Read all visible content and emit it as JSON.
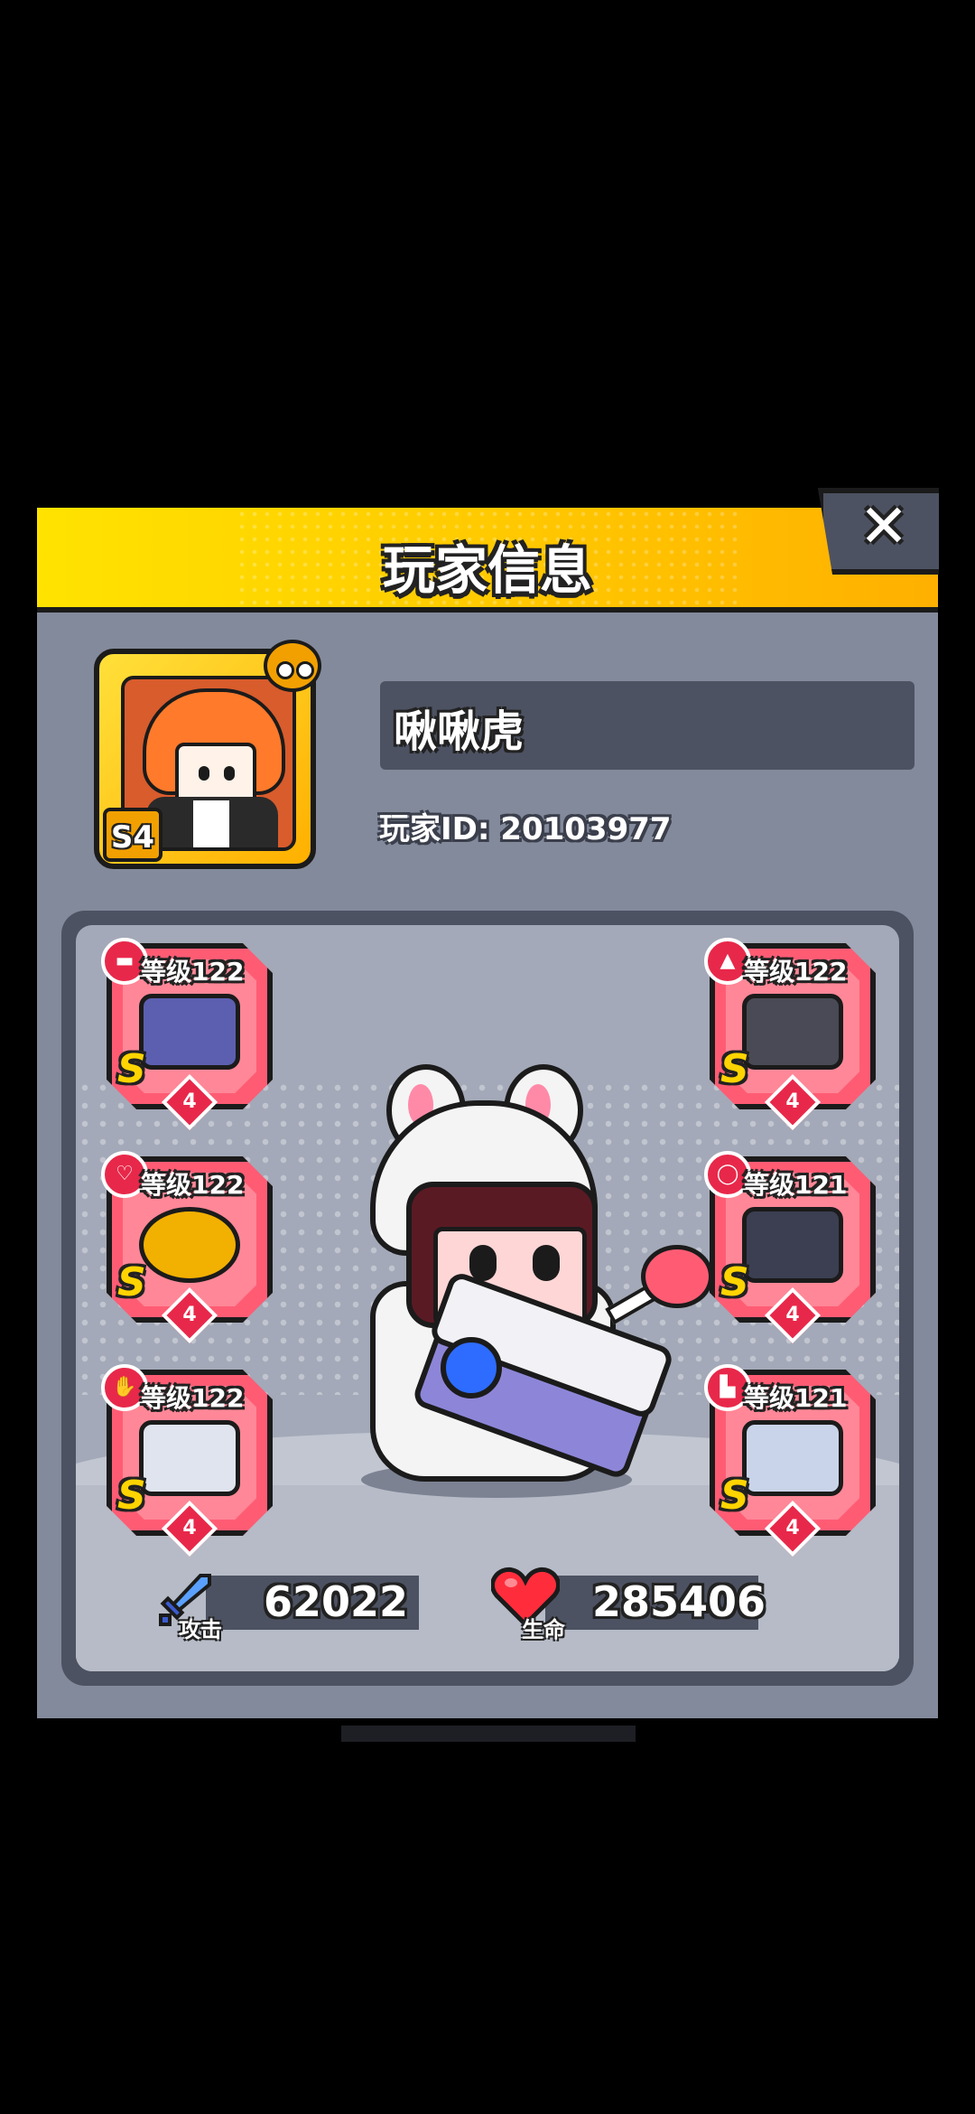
{
  "header": {
    "title": "玩家信息"
  },
  "close": {
    "icon": "close-icon",
    "label": "✕"
  },
  "player": {
    "name": "啾啾虎",
    "id_text": "玩家ID: 20103977",
    "season_badge": "S4"
  },
  "equipment": [
    {
      "slot": "weapon",
      "type_icon": "weapon-slot-icon",
      "level": "等级122",
      "rank": "S",
      "stars": "4",
      "item_color": "#5c5fb0"
    },
    {
      "slot": "armor",
      "type_icon": "armor-slot-icon",
      "level": "等级122",
      "rank": "S",
      "stars": "4",
      "item_color": "#4a4a56"
    },
    {
      "slot": "necklace",
      "type_icon": "necklace-slot-icon",
      "level": "等级122",
      "rank": "S",
      "stars": "4",
      "item_color": "#f2b000"
    },
    {
      "slot": "belt",
      "type_icon": "belt-slot-icon",
      "level": "等级121",
      "rank": "S",
      "stars": "4",
      "item_color": "#3c3f52"
    },
    {
      "slot": "gloves",
      "type_icon": "gloves-slot-icon",
      "level": "等级122",
      "rank": "S",
      "stars": "4",
      "item_color": "#dfe4ee"
    },
    {
      "slot": "boots",
      "type_icon": "boots-slot-icon",
      "level": "等级121",
      "rank": "S",
      "stars": "4",
      "item_color": "#c9d4ea"
    }
  ],
  "stats": {
    "attack_label": "攻击",
    "attack_value": "62022",
    "hp_label": "生命",
    "hp_value": "285406"
  },
  "colors": {
    "header": "#ffcf00",
    "panel": "#838a9b",
    "dark_box": "#4d5262",
    "slot_red": "#ff5c74",
    "rank_gold": "#ffd400"
  }
}
